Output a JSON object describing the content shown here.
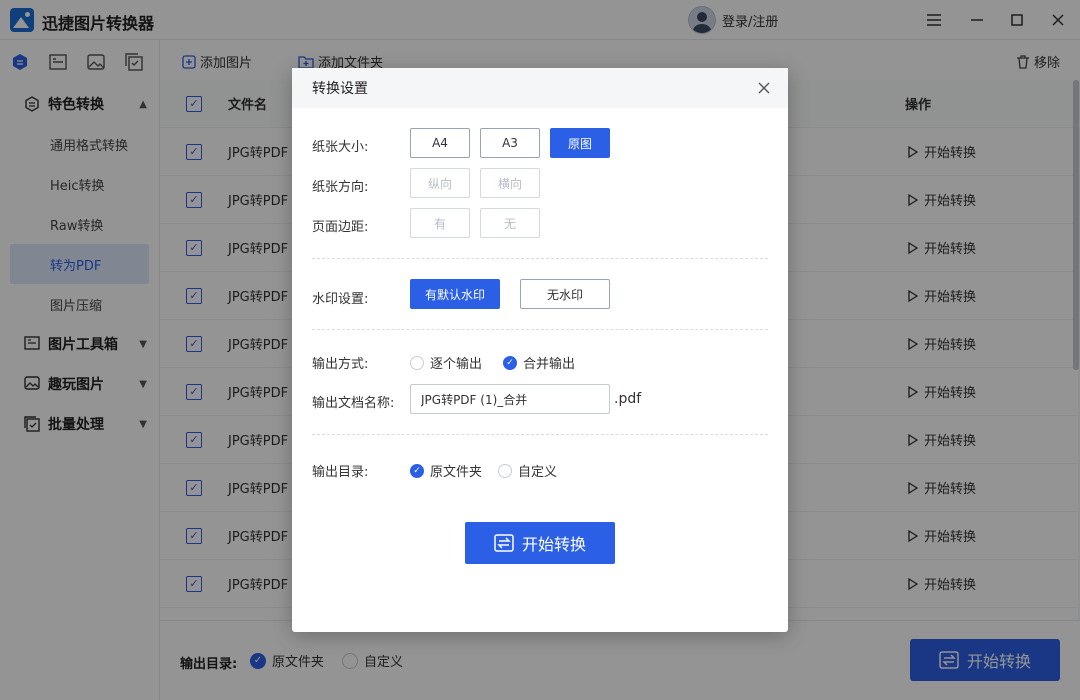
{
  "app": {
    "title": "迅捷图片转换器",
    "login_label": "登录/注册",
    "window_controls": [
      "menu-icon",
      "minimize-icon",
      "maximize-icon",
      "close-icon"
    ]
  },
  "sidebar": {
    "top_icons": [
      "feature-icon",
      "toolbox-icon",
      "image-icon",
      "batch-icon"
    ],
    "groups": [
      {
        "label": "特色转换",
        "icon": "feature-icon",
        "expanded": true,
        "items": [
          "通用格式转换",
          "Heic转换",
          "Raw转换",
          "转为PDF",
          "图片压缩"
        ],
        "active_item": "转为PDF"
      },
      {
        "label": "图片工具箱",
        "icon": "toolbox-icon",
        "expanded": false
      },
      {
        "label": "趣玩图片",
        "icon": "image-icon",
        "expanded": false
      },
      {
        "label": "批量处理",
        "icon": "batch-icon",
        "expanded": false
      }
    ]
  },
  "toolbar": {
    "add_image": "添加图片",
    "add_folder": "添加文件夹",
    "remove": "移除"
  },
  "table": {
    "headers": {
      "name": "文件名",
      "action": "操作"
    },
    "rows": [
      {
        "name": "JPG转PDF",
        "action": "开始转换"
      },
      {
        "name": "JPG转PDF",
        "action": "开始转换"
      },
      {
        "name": "JPG转PDF",
        "action": "开始转换"
      },
      {
        "name": "JPG转PDF",
        "action": "开始转换"
      },
      {
        "name": "JPG转PDF",
        "action": "开始转换"
      },
      {
        "name": "JPG转PDF",
        "action": "开始转换"
      },
      {
        "name": "JPG转PDF",
        "action": "开始转换"
      },
      {
        "name": "JPG转PDF",
        "action": "开始转换"
      },
      {
        "name": "JPG转PDF",
        "action": "开始转换"
      },
      {
        "name": "JPG转PDF",
        "action": "开始转换"
      }
    ]
  },
  "footer": {
    "output_label": "输出目录:",
    "options": [
      "原文件夹",
      "自定义"
    ],
    "selected": "原文件夹",
    "start_label": "开始转换"
  },
  "modal": {
    "title": "转换设置",
    "paper_size": {
      "label": "纸张大小:",
      "options": [
        "A4",
        "A3",
        "原图"
      ],
      "selected": "原图"
    },
    "orientation": {
      "label": "纸张方向:",
      "options": [
        "纵向",
        "横向"
      ],
      "disabled": true
    },
    "margin": {
      "label": "页面边距:",
      "options": [
        "有",
        "无"
      ],
      "disabled": true
    },
    "watermark": {
      "label": "水印设置:",
      "options": [
        "有默认水印",
        "无水印"
      ],
      "selected": "有默认水印"
    },
    "output_mode": {
      "label": "输出方式:",
      "options": [
        "逐个输出",
        "合并输出"
      ],
      "selected": "合并输出"
    },
    "doc_name": {
      "label": "输出文档名称:",
      "value": "JPG转PDF (1)_合并",
      "extension": ".pdf"
    },
    "output_dir": {
      "label": "输出目录:",
      "options": [
        "原文件夹",
        "自定义"
      ],
      "selected": "原文件夹"
    },
    "start_label": "开始转换"
  },
  "colors": {
    "accent": "#2b5fe6",
    "overlay": "rgba(0,0,0,0.42)"
  }
}
